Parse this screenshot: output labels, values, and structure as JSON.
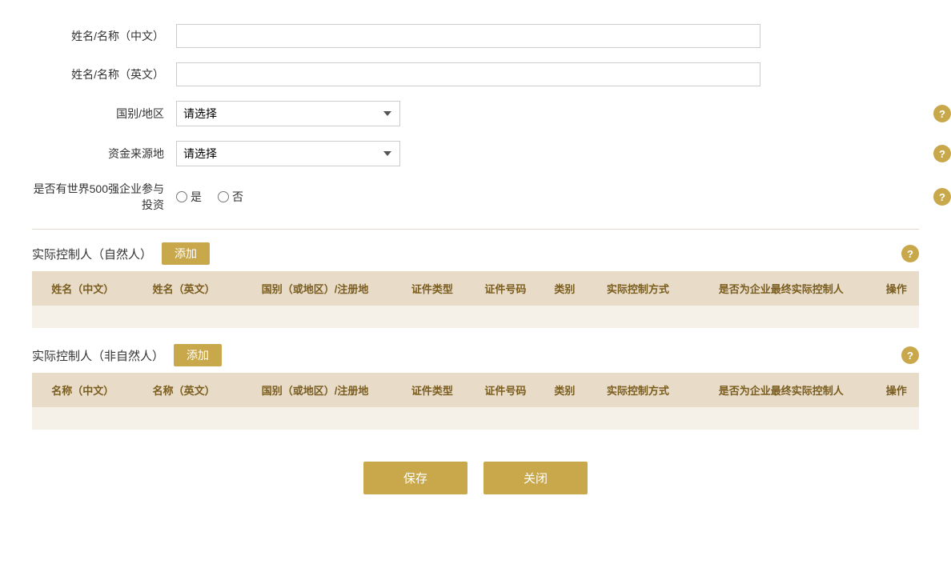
{
  "form": {
    "name_cn_label": "姓名/名称（中文）",
    "name_en_label": "姓名/名称（英文）",
    "country_label": "国别/地区",
    "fund_source_label": "资金来源地",
    "fortune500_label": "是否有世界500强企业参与投资",
    "country_placeholder": "请选择",
    "fund_source_placeholder": "请选择",
    "yes_label": "是",
    "no_label": "否"
  },
  "section1": {
    "title": "实际控制人（自然人）",
    "add_label": "添加",
    "help_icon": "?",
    "columns": [
      "姓名（中文）",
      "姓名（英文）",
      "国别（或地区）/注册地",
      "证件类型",
      "证件号码",
      "类别",
      "实际控制方式",
      "是否为企业最终实际控制人",
      "操作"
    ]
  },
  "section2": {
    "title": "实际控制人（非自然人）",
    "add_label": "添加",
    "help_icon": "?",
    "columns": [
      "名称（中文）",
      "名称（英文）",
      "国别（或地区）/注册地",
      "证件类型",
      "证件号码",
      "类别",
      "实际控制方式",
      "是否为企业最终实际控制人",
      "操作"
    ]
  },
  "footer": {
    "save_label": "保存",
    "close_label": "关闭"
  },
  "icons": {
    "help": "?",
    "dropdown": "▼"
  }
}
